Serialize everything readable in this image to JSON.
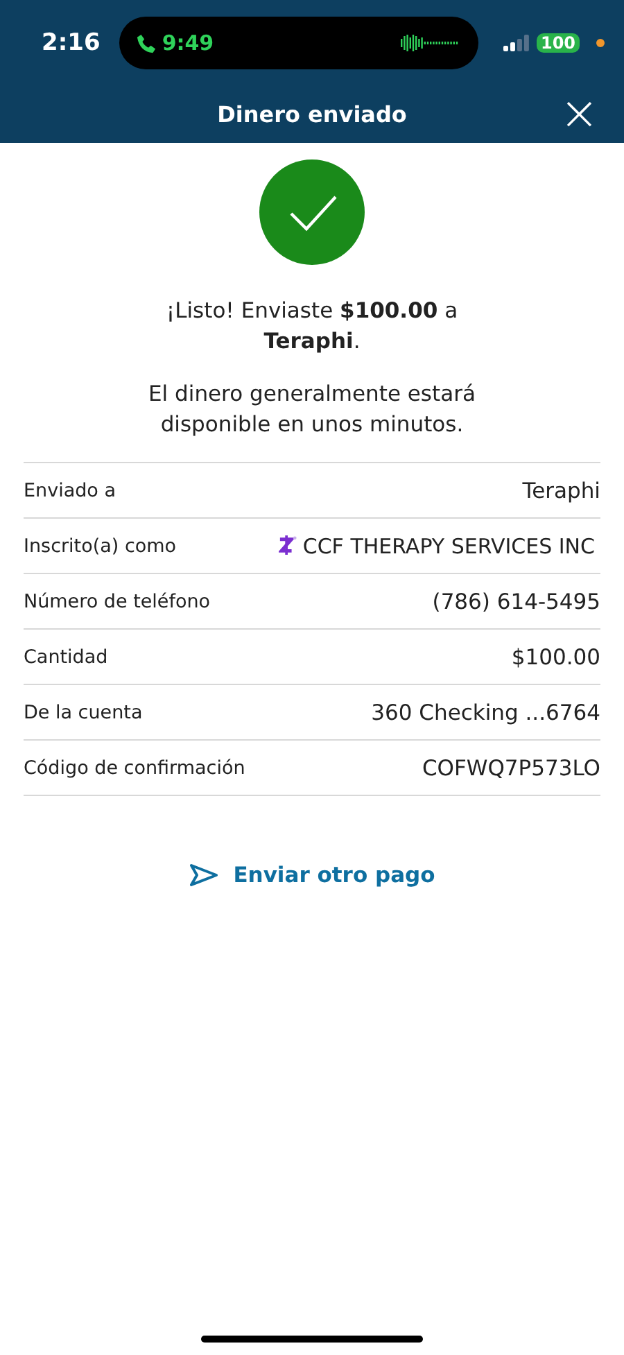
{
  "status_bar": {
    "time": "2:16",
    "call_time": "9:49",
    "battery": "100"
  },
  "header": {
    "title": "Dinero enviado",
    "close": "×"
  },
  "success": {
    "message": "¡Listo! Enviaste **$100.00** a **Teraphi**.",
    "note": "El dinero generalmente estará disponible en unos minutos."
  },
  "details": [
    {
      "label": "Enviado a",
      "value": "Teraphi",
      "kind": "plain"
    },
    {
      "label": "Inscrito(a) como",
      "value": "CCF THERAPY SERVICES INC",
      "kind": "zelle"
    },
    {
      "label": "Número de teléfono",
      "value": "(786) 614-5495",
      "kind": "plain"
    },
    {
      "label": "Cantidad",
      "value": "$100.00",
      "kind": "plain"
    },
    {
      "label": "De la cuenta",
      "value": "360 Checking ...6764",
      "kind": "plain"
    },
    {
      "label": "Código de confirmación",
      "value": "COFWQ7P573LO",
      "kind": "plain"
    }
  ],
  "action": {
    "label": "Enviar otro pago"
  }
}
